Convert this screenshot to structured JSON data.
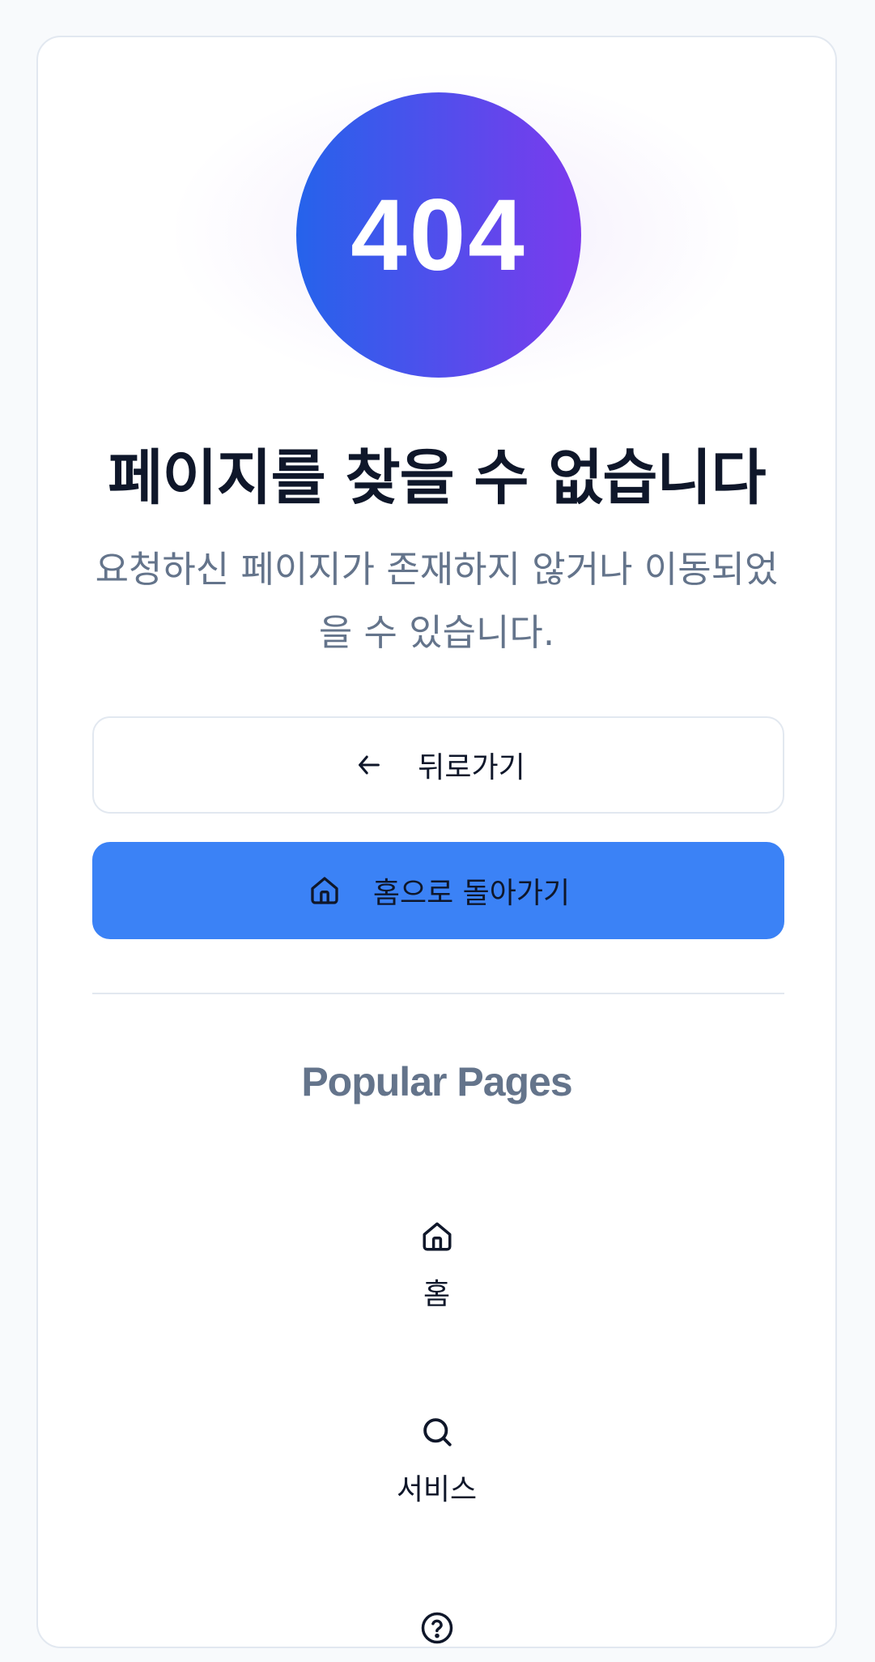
{
  "error": {
    "code": "404",
    "title": "페이지를 찾을 수 없습니다",
    "description": "요청하신 페이지가 존재하지 않거나 이동되었을 수 있습니다."
  },
  "actions": {
    "back_label": "뒤로가기",
    "back_icon": "arrow-left-icon",
    "home_label": "홈으로 돌아가기",
    "home_icon": "home-icon"
  },
  "popular": {
    "title": "Popular Pages",
    "items": [
      {
        "label": "홈",
        "icon": "home-icon"
      },
      {
        "label": "서비스",
        "icon": "search-icon"
      },
      {
        "label": "",
        "icon": "help-circle-icon"
      }
    ]
  },
  "colors": {
    "gradient_start": "#2563eb",
    "gradient_end": "#7c3aed",
    "primary_button": "#3b82f6",
    "muted_text": "#64748b",
    "heading_text": "#0f172a",
    "border": "#e2e8f0"
  }
}
